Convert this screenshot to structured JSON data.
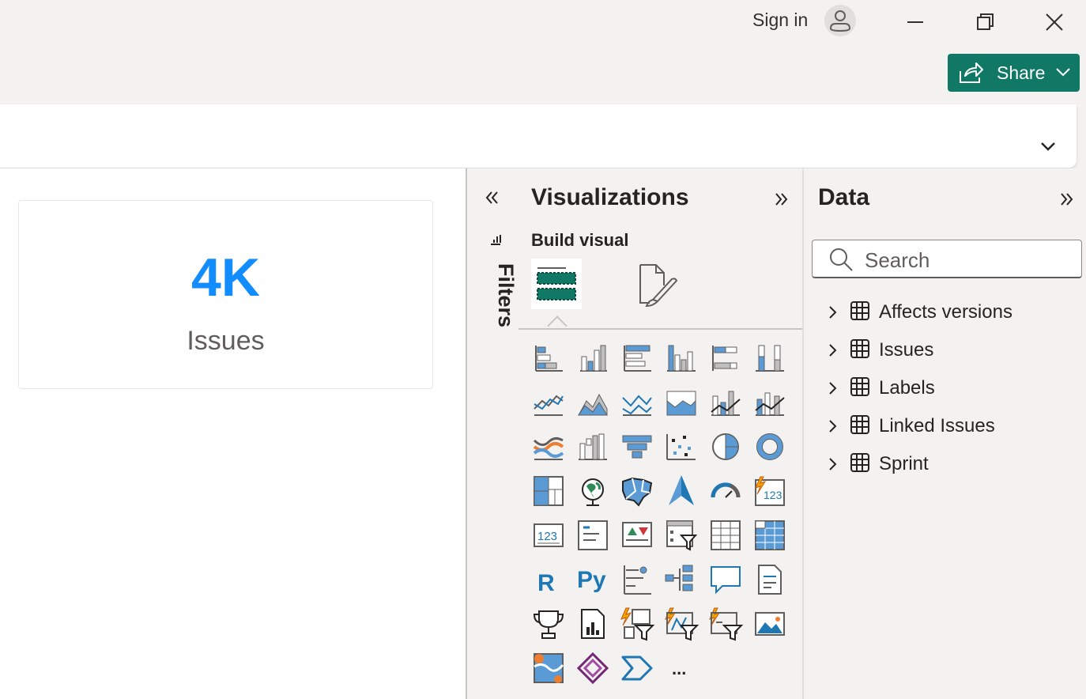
{
  "titlebar": {
    "signin_label": "Sign in",
    "share_label": "Share"
  },
  "canvas": {
    "card": {
      "value": "4K",
      "label": "Issues"
    }
  },
  "filters": {
    "label": "Filters"
  },
  "visualizations": {
    "title": "Visualizations",
    "build_visual_label": "Build visual",
    "icons": [
      "stacked-bar-chart-icon",
      "stacked-column-chart-icon",
      "clustered-bar-chart-icon",
      "clustered-column-chart-icon",
      "100-stacked-bar-chart-icon",
      "100-stacked-column-chart-icon",
      "line-chart-icon",
      "area-chart-icon",
      "stacked-area-chart-icon",
      "100-stacked-area-chart-icon",
      "line-and-stacked-column-chart-icon",
      "line-and-clustered-column-chart-icon",
      "ribbon-chart-icon",
      "waterfall-chart-icon",
      "funnel-chart-icon",
      "scatter-chart-icon",
      "pie-chart-icon",
      "donut-chart-icon",
      "treemap-icon",
      "map-icon",
      "filled-map-icon",
      "azure-map-icon",
      "gauge-icon",
      "card-icon",
      "multi-row-card-icon",
      "kpi-icon",
      "slicer-icon",
      "table-icon",
      "matrix-icon",
      "r-visual-icon",
      "python-visual-icon",
      "key-influencers-icon",
      "decomposition-tree-icon",
      "qa-icon",
      "smart-narrative-icon",
      "paginated-report-icon",
      "metrics-icon",
      "power-apps-icon",
      "power-automate-icon",
      "image-icon",
      "more-visuals-icon"
    ],
    "r_label": "R",
    "py_label": "Py",
    "more_label": "..."
  },
  "data_pane": {
    "title": "Data",
    "search_placeholder": "Search",
    "tables": [
      "Affects versions",
      "Issues",
      "Labels",
      "Linked Issues",
      "Sprint"
    ]
  },
  "colors": {
    "accent": "#118dff",
    "share_bg": "#117865",
    "build_visual_green": "#117865"
  }
}
